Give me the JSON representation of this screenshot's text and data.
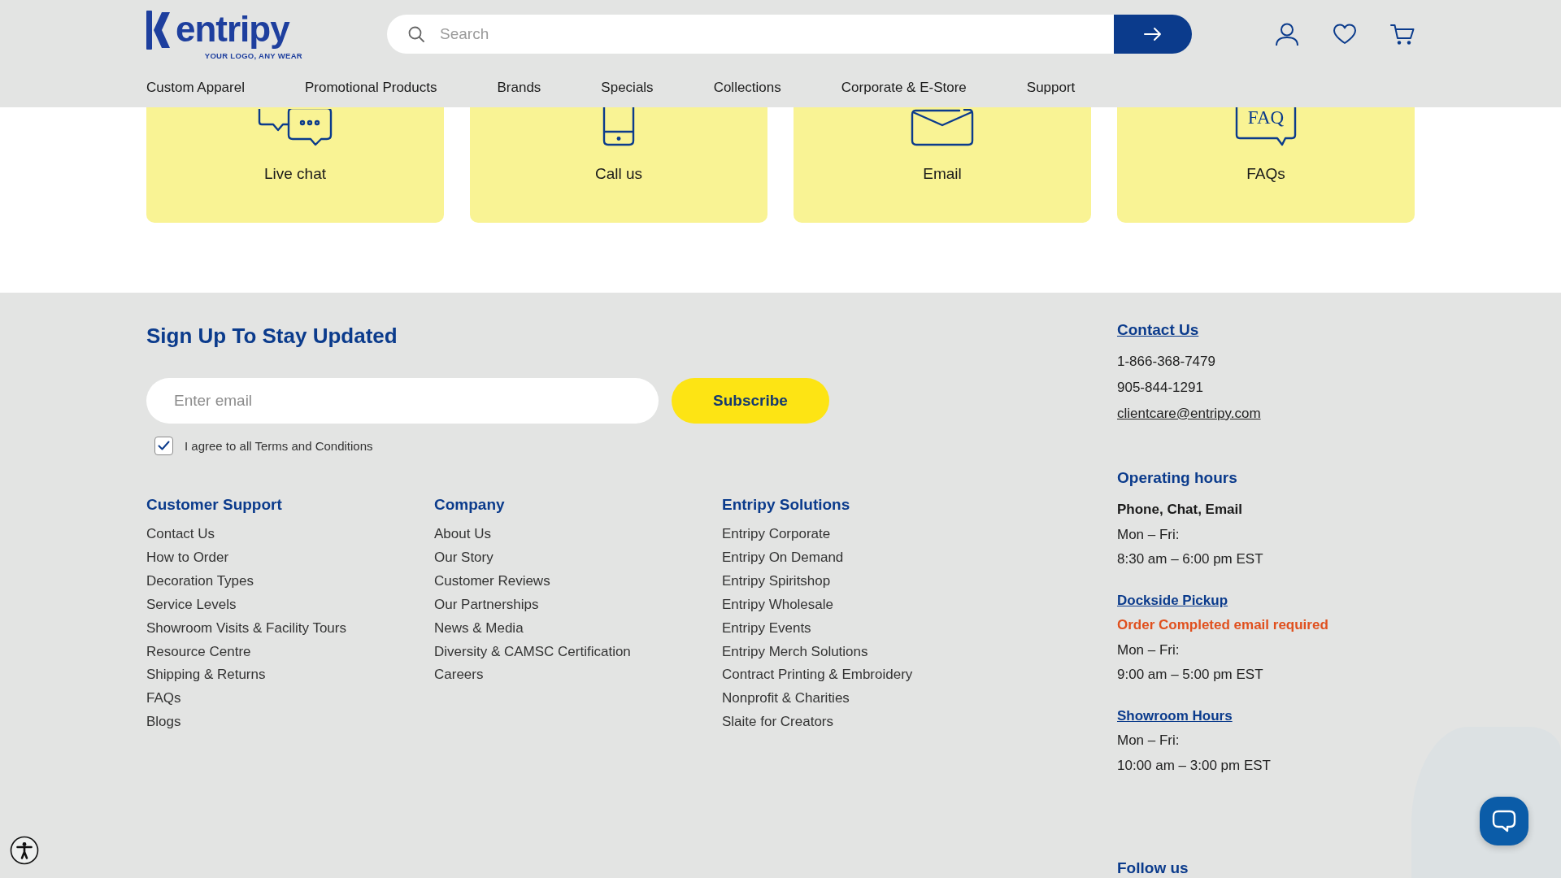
{
  "header": {
    "logo": {
      "wordmark": "entripy",
      "tagline": "YOUR LOGO, ANY WEAR"
    },
    "search": {
      "placeholder": "Search"
    },
    "nav": [
      "Custom Apparel",
      "Promotional Products",
      "Brands",
      "Specials",
      "Collections",
      "Corporate & E-Store",
      "Support"
    ]
  },
  "contact_cards": [
    {
      "kind": "chat",
      "label": "Live chat"
    },
    {
      "kind": "phone",
      "label": "Call us"
    },
    {
      "kind": "email",
      "label": "Email"
    },
    {
      "kind": "faq",
      "label": "FAQs",
      "icon_text": "FAQ"
    }
  ],
  "newsletter": {
    "heading": "Sign Up To Stay Updated",
    "email_field": {
      "placeholder": "Enter email"
    },
    "subscribe_button": "Subscribe",
    "terms": {
      "label": "I agree to all Terms and Conditions",
      "checked": true
    }
  },
  "link_columns": [
    {
      "heading": "Customer Support",
      "links": [
        "Contact Us",
        "How to Order",
        "Decoration Types",
        "Service Levels",
        "Showroom Visits & Facility Tours",
        "Resource Centre",
        "Shipping & Returns",
        "FAQs",
        "Blogs"
      ]
    },
    {
      "heading": "Company",
      "links": [
        "About Us",
        "Our Story",
        "Customer Reviews",
        "Our Partnerships",
        "News & Media",
        "Diversity & CAMSC Certification",
        "Careers"
      ]
    },
    {
      "heading": "Entripy Solutions",
      "links": [
        "Entripy Corporate",
        "Entripy On Demand",
        "Entripy Spiritshop",
        "Entripy Wholesale",
        "Entripy Events",
        "Entripy Merch Solutions",
        "Contract Printing & Embroidery",
        "Nonprofit & Charities",
        "Slaite for Creators"
      ]
    }
  ],
  "contact": {
    "heading": "Contact Us",
    "phones": [
      "1-866-368-7479",
      "905-844-1291"
    ],
    "email": "clientcare@entripy.com"
  },
  "operating_hours": {
    "heading": "Operating hours",
    "groups": [
      {
        "kind": "label",
        "title": "Phone, Chat, Email",
        "lines": [
          "Mon – Fri:",
          "8:30 am – 6:00 pm EST"
        ]
      },
      {
        "kind": "link",
        "title": "Dockside Pickup",
        "note": "Order Completed email required",
        "lines": [
          "Mon – Fri:",
          "9:00 am – 5:00 pm EST"
        ]
      },
      {
        "kind": "link",
        "title": "Showroom Hours",
        "lines": [
          "Mon – Fri:",
          "10:00 am – 3:00 pm EST"
        ]
      }
    ]
  },
  "follow_us": {
    "heading": "Follow us"
  }
}
